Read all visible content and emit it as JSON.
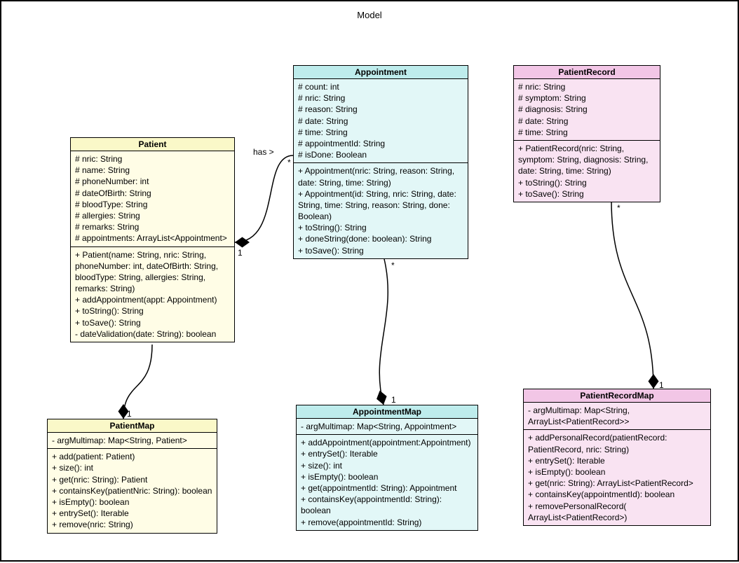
{
  "frame_title": "Model",
  "patient": {
    "title": "Patient",
    "attrs": [
      "# nric: String",
      "# name: String",
      "# phoneNumber: int",
      "# dateOfBirth: String",
      "# bloodType: String",
      "# allergies: String",
      "# remarks: String",
      "# appointments: ArrayList<Appointment>"
    ],
    "methods": [
      "+ Patient(name: String, nric: String, phoneNumber: int, dateOfBirth: String, bloodType: String, allergies: String, remarks: String)",
      "+ addAppointment(appt: Appointment)",
      "+ toString(): String",
      "+ toSave(): String",
      "- dateValidation(date: String): boolean"
    ]
  },
  "appointment": {
    "title": "Appointment",
    "attrs": [
      "# count: int",
      "# nric: String",
      "# reason: String",
      "# date: String",
      "# time: String",
      "# appointmentId: String",
      "# isDone: Boolean"
    ],
    "methods": [
      "+ Appointment(nric: String, reason: String, date: String, time: String)",
      "+ Appointment(id: String, nric: String, date: String, time: String, reason: String, done: Boolean)",
      "+ toString(): String",
      "+ doneString(done: boolean): String",
      "+ toSave(): String"
    ]
  },
  "patientRecord": {
    "title": "PatientRecord",
    "attrs": [
      "# nric: String",
      "# symptom: String",
      "# diagnosis: String",
      "# date: String",
      "# time: String"
    ],
    "methods": [
      "+ PatientRecord(nric: String, symptom: String, diagnosis: String, date: String, time: String)",
      "+ toString(): String",
      "+ toSave(): String"
    ]
  },
  "patientMap": {
    "title": "PatientMap",
    "attrs": [
      "- argMultimap: Map<String, Patient>"
    ],
    "methods": [
      "+ add(patient: Patient)",
      "+ size(): int",
      "+ get(nric: String): Patient",
      "+ containsKey(patientNric: String): boolean",
      "+ isEmpty(): boolean",
      "+ entrySet(): Iterable",
      "+ remove(nric: String)"
    ]
  },
  "appointmentMap": {
    "title": "AppointmentMap",
    "attrs": [
      "- argMultimap: Map<String, Appointment>"
    ],
    "methods": [
      "+ addAppointment(appointment:Appointment)",
      "+ entrySet(): Iterable",
      "+ size(): int",
      "+ isEmpty(): boolean",
      "+ get(appointmentId: String): Appointment",
      "+ containsKey(appointmentId: String): boolean",
      "+ remove(appointmentId: String)"
    ]
  },
  "patientRecordMap": {
    "title": "PatientRecordMap",
    "attrs": [
      "- argMultimap: Map<String, ArrayList<PatientRecord>>"
    ],
    "methods": [
      "+ addPersonalRecord(patientRecord: PatientRecord, nric: String)",
      "+ entrySet(): Iterable",
      "+ isEmpty(): boolean",
      "+ get(nric: String): ArrayList<PatientRecord>",
      "+ containsKey(appointmentId): boolean",
      "+ removePersonalRecord( ArrayList<PatientRecord>)"
    ]
  },
  "labels": {
    "has": "has >",
    "star": "*",
    "one": "1"
  },
  "chart_data": {
    "type": "uml_class_diagram",
    "package": "Model",
    "classes": [
      {
        "name": "Patient",
        "stereotype": null,
        "attributes": [
          "# nric: String",
          "# name: String",
          "# phoneNumber: int",
          "# dateOfBirth: String",
          "# bloodType: String",
          "# allergies: String",
          "# remarks: String",
          "# appointments: ArrayList<Appointment>"
        ],
        "operations": [
          "+ Patient(name: String, nric: String, phoneNumber: int, dateOfBirth: String, bloodType: String, allergies: String, remarks: String)",
          "+ addAppointment(appt: Appointment)",
          "+ toString(): String",
          "+ toSave(): String",
          "- dateValidation(date: String): boolean"
        ]
      },
      {
        "name": "Appointment",
        "attributes": [
          "# count: int",
          "# nric: String",
          "# reason: String",
          "# date: String",
          "# time: String",
          "# appointmentId: String",
          "# isDone: Boolean"
        ],
        "operations": [
          "+ Appointment(nric: String, reason: String, date: String, time: String)",
          "+ Appointment(id: String, nric: String, date: String, time: String, reason: String, done: Boolean)",
          "+ toString(): String",
          "+ doneString(done: boolean): String",
          "+ toSave(): String"
        ]
      },
      {
        "name": "PatientRecord",
        "attributes": [
          "# nric: String",
          "# symptom: String",
          "# diagnosis: String",
          "# date: String",
          "# time: String"
        ],
        "operations": [
          "+ PatientRecord(nric: String, symptom: String, diagnosis: String, date: String, time: String)",
          "+ toString(): String",
          "+ toSave(): String"
        ]
      },
      {
        "name": "PatientMap",
        "attributes": [
          "- argMultimap: Map<String, Patient>"
        ],
        "operations": [
          "+ add(patient: Patient)",
          "+ size(): int",
          "+ get(nric: String): Patient",
          "+ containsKey(patientNric: String): boolean",
          "+ isEmpty(): boolean",
          "+ entrySet(): Iterable",
          "+ remove(nric: String)"
        ]
      },
      {
        "name": "AppointmentMap",
        "attributes": [
          "- argMultimap: Map<String, Appointment>"
        ],
        "operations": [
          "+ addAppointment(appointment:Appointment)",
          "+ entrySet(): Iterable",
          "+ size(): int",
          "+ isEmpty(): boolean",
          "+ get(appointmentId: String): Appointment",
          "+ containsKey(appointmentId: String): boolean",
          "+ remove(appointmentId: String)"
        ]
      },
      {
        "name": "PatientRecordMap",
        "attributes": [
          "- argMultimap: Map<String, ArrayList<PatientRecord>>"
        ],
        "operations": [
          "+ addPersonalRecord(patientRecord: PatientRecord, nric: String)",
          "+ entrySet(): Iterable",
          "+ isEmpty(): boolean",
          "+ get(nric: String): ArrayList<PatientRecord>",
          "+ containsKey(appointmentId): boolean",
          "+ removePersonalRecord( ArrayList<PatientRecord>)"
        ]
      }
    ],
    "relationships": [
      {
        "type": "composition",
        "whole": "Patient",
        "part": "Appointment",
        "label": "has",
        "whole_multiplicity": "1",
        "part_multiplicity": "*"
      },
      {
        "type": "composition",
        "whole": "PatientMap",
        "part": "Patient",
        "whole_multiplicity": "1",
        "part_multiplicity": "*"
      },
      {
        "type": "composition",
        "whole": "AppointmentMap",
        "part": "Appointment",
        "whole_multiplicity": "1",
        "part_multiplicity": "*"
      },
      {
        "type": "composition",
        "whole": "PatientRecordMap",
        "part": "PatientRecord",
        "whole_multiplicity": "1",
        "part_multiplicity": "*"
      }
    ]
  }
}
